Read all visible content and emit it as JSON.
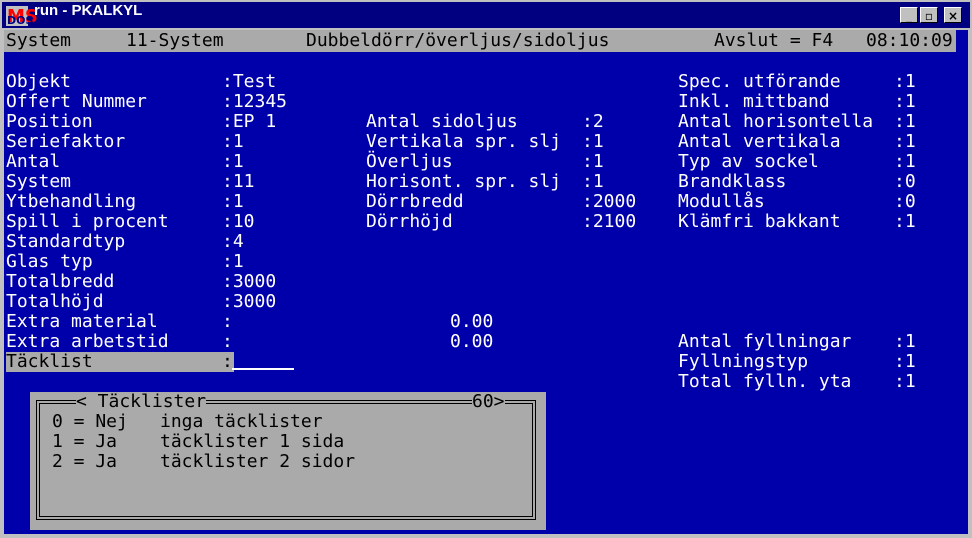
{
  "window": {
    "title": "run - PKALKYL",
    "icon_top": "MS",
    "icon_bottom": "DOS",
    "min_glyph": "_",
    "restore_glyph": "▫",
    "close_glyph": "×"
  },
  "status": {
    "left": "System",
    "module": "11-System",
    "screen": "Dubbeldörr/överljus/sidoljus",
    "exit": "Avslut = F4",
    "time": "08:10:09"
  },
  "col1": [
    {
      "label": "Objekt",
      "value": ":Test"
    },
    {
      "label": "Offert Nummer",
      "value": ":12345"
    },
    {
      "label": "Position",
      "value": ":EP 1"
    },
    {
      "label": "Seriefaktor",
      "value": ":1"
    },
    {
      "label": "Antal",
      "value": ":1"
    },
    {
      "label": "System",
      "value": ":11"
    },
    {
      "label": "Ytbehandling",
      "value": ":1"
    },
    {
      "label": "Spill i procent",
      "value": ":10"
    },
    {
      "label": "Standardtyp",
      "value": ":4"
    },
    {
      "label": "Glas typ",
      "value": ":1"
    },
    {
      "label": "Totalbredd",
      "value": ":3000"
    },
    {
      "label": "Totalhöjd",
      "value": ":3000"
    },
    {
      "label": "Extra material",
      "value": ":",
      "amount": "0.00"
    },
    {
      "label": "Extra arbetstid",
      "value": ":",
      "amount": "0.00"
    }
  ],
  "active_field": {
    "label": "Täcklist",
    "value": ":"
  },
  "col2": [
    {
      "label": "Antal sidoljus",
      "value": ":2"
    },
    {
      "label": "Vertikala spr. slj",
      "value": ":1"
    },
    {
      "label": "Överljus",
      "value": ":1"
    },
    {
      "label": "Horisont. spr. slj",
      "value": ":1"
    },
    {
      "label": "Dörrbredd",
      "value": ":2000"
    },
    {
      "label": "Dörrhöjd",
      "value": ":2100"
    }
  ],
  "col3": [
    {
      "label": "Spec. utförande",
      "value": ":1"
    },
    {
      "label": "Inkl. mittband",
      "value": ":1"
    },
    {
      "label": "Antal horisontella",
      "value": ":1"
    },
    {
      "label": "Antal vertikala",
      "value": ":1"
    },
    {
      "label": "Typ av sockel",
      "value": ":1"
    },
    {
      "label": "Brandklass",
      "value": ":0"
    },
    {
      "label": "Modullås",
      "value": ":0"
    },
    {
      "label": "Klämfri bakkant",
      "value": ":1"
    }
  ],
  "col3_lower": [
    {
      "label": "Antal fyllningar",
      "value": ":1"
    },
    {
      "label": "Fyllningstyp",
      "value": ":1"
    },
    {
      "label": "Total fylln. yta",
      "value": ":1"
    }
  ],
  "popup": {
    "title": "< Täcklister",
    "code": "60>",
    "options": [
      {
        "key": "0 = Nej",
        "text": "inga täcklister"
      },
      {
        "key": "1 = Ja",
        "text": "täcklister 1 sida"
      },
      {
        "key": "2 = Ja",
        "text": "täcklister 2 sidor"
      }
    ]
  }
}
